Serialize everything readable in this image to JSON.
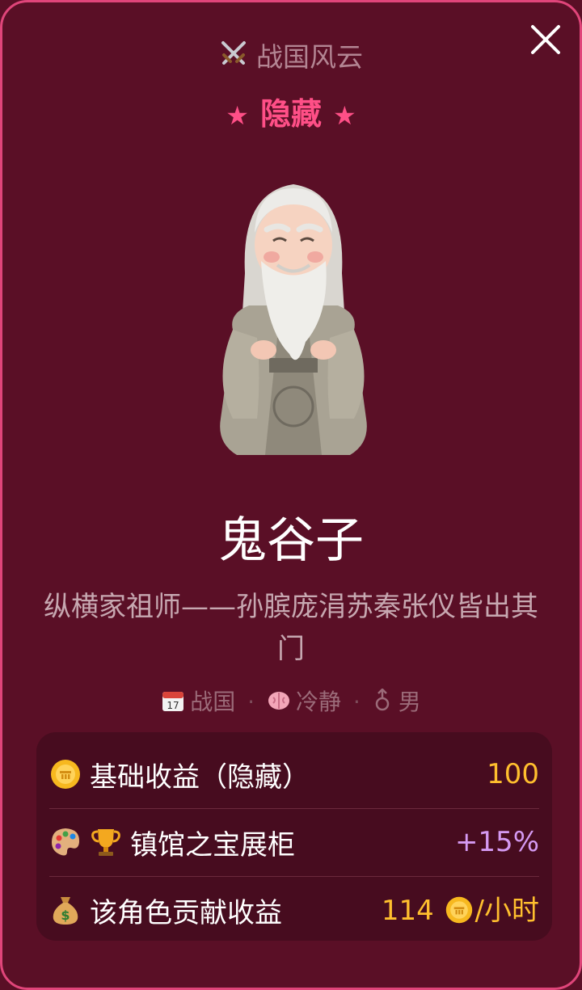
{
  "header": {
    "era_label": "战国风云",
    "rarity_label": "隐藏",
    "star_glyph": "★"
  },
  "character": {
    "name": "鬼谷子",
    "description": "纵横家祖师——孙膑庞涓苏秦张仪皆出其门",
    "tags": {
      "era": "战国",
      "temperament": "冷静",
      "gender": "男",
      "separator": "·"
    }
  },
  "stats": {
    "base_income_label": "基础收益（隐藏）",
    "base_income_value": "100",
    "showcase_label": "镇馆之宝展柜",
    "showcase_value": "+15%",
    "contribution_label": "该角色贡献收益",
    "contribution_amount": "114",
    "contribution_unit": "/小时"
  },
  "icons": {
    "close": "close-icon",
    "era": "crossed-swords-icon",
    "calendar": "calendar-icon",
    "brain": "brain-icon",
    "gender": "male-symbol-icon",
    "coin": "coin-icon",
    "palette": "palette-icon",
    "trophy": "trophy-icon",
    "money_bag": "money-bag-icon"
  },
  "colors": {
    "background": "#5a0f26",
    "border": "#e0457a",
    "rarity": "#ff4f87",
    "gold": "#ffbf2e",
    "purple": "#d59af2"
  }
}
